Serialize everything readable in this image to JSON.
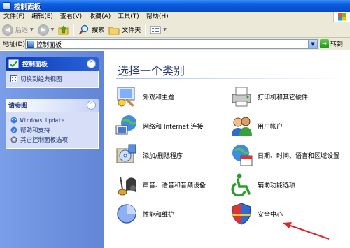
{
  "window": {
    "title": "控制面板"
  },
  "menu": [
    "文件(F)",
    "编辑(E)",
    "查看(V)",
    "收藏(A)",
    "工具(T)",
    "帮助(H)"
  ],
  "toolbar": {
    "back": "后退",
    "search": "搜索",
    "folders": "文件夹"
  },
  "address": {
    "label": "地址(D)",
    "value": "控制面板",
    "go": "转到"
  },
  "sidebar": {
    "main_panel": {
      "title": "控制面板",
      "link": "切换到经典视图"
    },
    "see_also": {
      "title": "请参阅",
      "links": [
        "Windows Update",
        "帮助和支持",
        "其它控制面板选项"
      ]
    }
  },
  "main": {
    "heading": "选择一个类别",
    "categories": [
      {
        "label": "外观和主题",
        "icon": "appearance-icon"
      },
      {
        "label": "打印机和其它硬件",
        "icon": "printer-icon"
      },
      {
        "label": "网络和 Internet 连接",
        "icon": "network-icon"
      },
      {
        "label": "用户帐户",
        "icon": "users-icon"
      },
      {
        "label": "添加/删除程序",
        "icon": "add-remove-programs-icon"
      },
      {
        "label": "日期、时间、语言和区域设置",
        "icon": "date-time-icon"
      },
      {
        "label": "声音、语音和音频设备",
        "icon": "sound-icon"
      },
      {
        "label": "辅助功能选项",
        "icon": "accessibility-icon"
      },
      {
        "label": "性能和维护",
        "icon": "performance-icon"
      },
      {
        "label": "安全中心",
        "icon": "security-shield-icon"
      }
    ]
  },
  "colors": {
    "title_bar": "#0753d6",
    "sidebar": "#7a9ee8",
    "arrow": "#d9262c"
  }
}
